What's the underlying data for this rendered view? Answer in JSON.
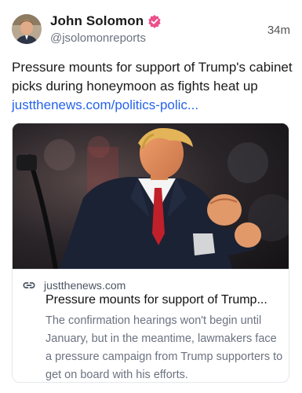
{
  "author": {
    "name": "John Solomon",
    "handle": "@jsolomonreports",
    "verified": true,
    "badge_color": "#ec4f8a"
  },
  "post": {
    "timestamp": "34m",
    "text": "Pressure mounts for support of Trump's cabinet picks during honeymoon as fights heat up ",
    "link_text": "justthenews.com/politics-polic...",
    "link_color": "#2563eb"
  },
  "card": {
    "domain": "justthenews.com",
    "title": "Pressure mounts for support of Trump...",
    "description": "The confirmation hearings won't begin until January, but in the meantime, lawmakers face a pressure campaign from Trump supporters to get on board with his efforts."
  },
  "icons": {
    "verified": "verified-badge-icon",
    "link": "link-icon"
  }
}
